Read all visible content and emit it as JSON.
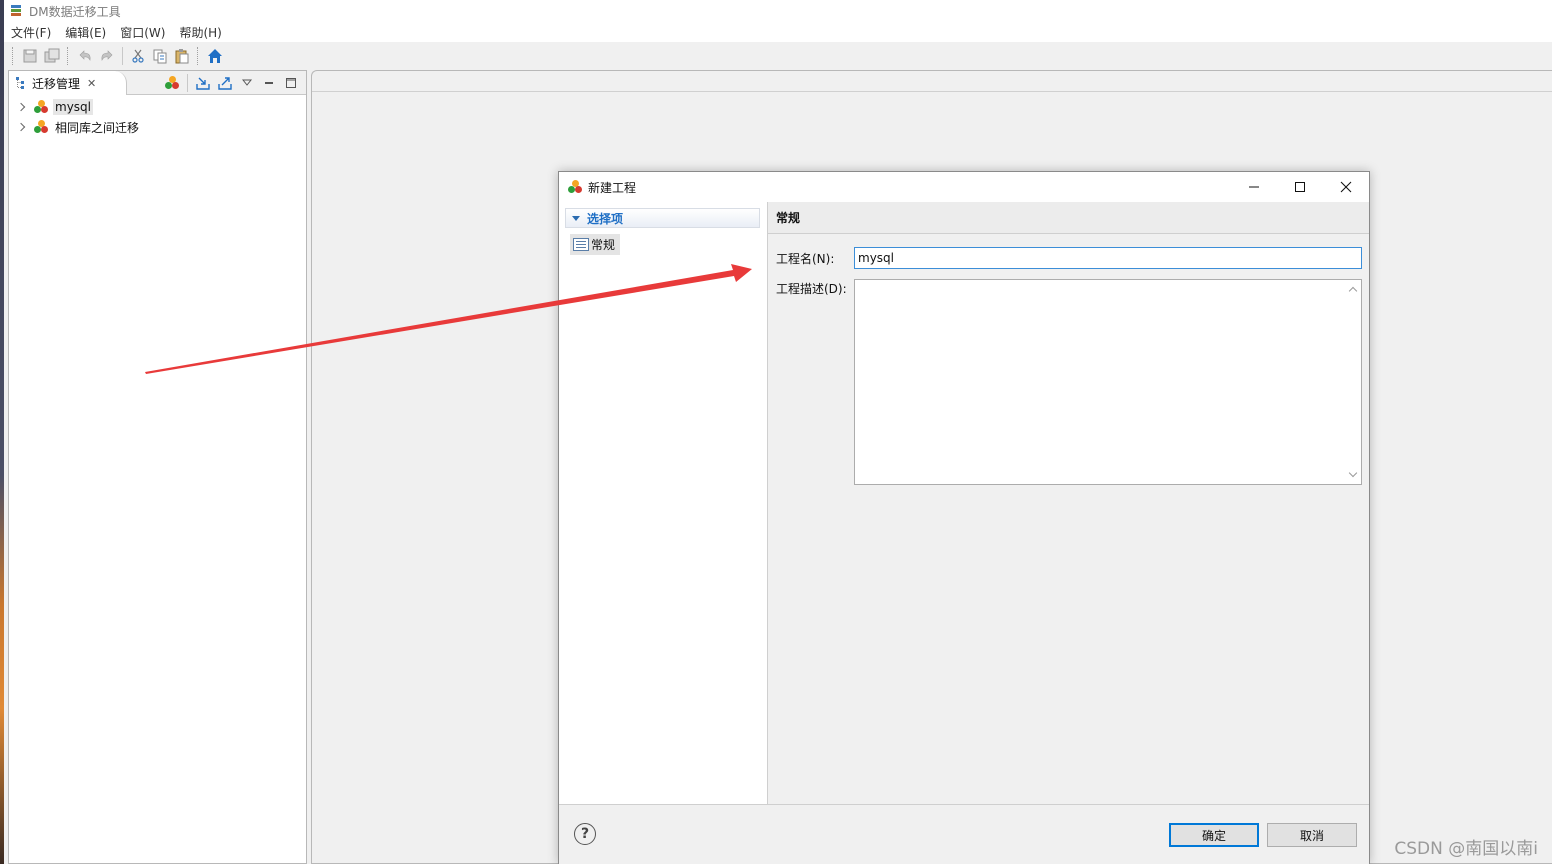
{
  "window": {
    "title": "DM数据迁移工具"
  },
  "menu": [
    {
      "label": "文件(F)"
    },
    {
      "label": "编辑(E)"
    },
    {
      "label": "窗口(W)"
    },
    {
      "label": "帮助(H)"
    }
  ],
  "toolbar": {
    "icons": [
      "save-icon",
      "save-all-icon",
      "undo-icon",
      "redo-icon",
      "cut-icon",
      "copy-icon",
      "paste-icon",
      "home-icon"
    ]
  },
  "left_panel": {
    "tab_label": "迁移管理",
    "tree": [
      {
        "label": "mysql",
        "selected": true
      },
      {
        "label": "相同库之间迁移",
        "selected": false
      }
    ]
  },
  "dialog": {
    "title": "新建工程",
    "nav_section": "选择项",
    "nav_item": "常规",
    "section_title": "常规",
    "name_label": "工程名(N):",
    "name_value": "mysql",
    "desc_label": "工程描述(D):",
    "desc_value": "",
    "ok_label": "确定",
    "cancel_label": "取消"
  },
  "watermark": "CSDN @南国以南i",
  "colors": {
    "accent": "#0078d7",
    "arrow": "#e83a3a",
    "nav_link": "#1f6fc5"
  }
}
